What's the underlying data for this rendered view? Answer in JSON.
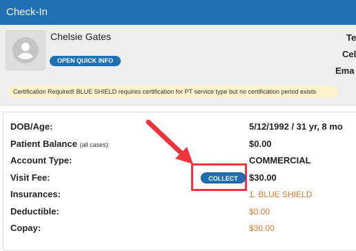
{
  "header": {
    "title": "Check-In"
  },
  "patient": {
    "name": "Chelsie Gates",
    "quick_info_label": "OPEN QUICK INFO",
    "right_labels": [
      "Te",
      "Cel",
      "Ema"
    ]
  },
  "certification_banner": "Certification Required! BLUE SHIELD requires certification for PT service type but no certification period exists",
  "details": {
    "dob_age": {
      "label": "DOB/Age:",
      "value": "5/12/1992 / 31 yr, 8 mo"
    },
    "patient_balance": {
      "label": "Patient Balance",
      "qualifier": "(all cases):",
      "value": "$0.00"
    },
    "account_type": {
      "label": "Account Type:",
      "value": "COMMERCIAL"
    },
    "visit_fee": {
      "label": "Visit Fee:",
      "value": "$30.00",
      "button_label": "COLLECT"
    },
    "insurances": {
      "label": "Insurances:",
      "value": "1. BLUE SHIELD"
    },
    "deductible": {
      "label": "Deductible:",
      "value": "$0.00"
    },
    "copay": {
      "label": "Copay:",
      "value": "$30.00"
    }
  },
  "colors": {
    "header_blue": "#1f6fb4",
    "highlight_red": "#f0333c",
    "insurance_orange": "#e07a2e",
    "banner_yellow": "#fdf2cc"
  },
  "icons": {
    "avatar": "user-avatar-icon",
    "annotation": "red-arrow-icon"
  }
}
